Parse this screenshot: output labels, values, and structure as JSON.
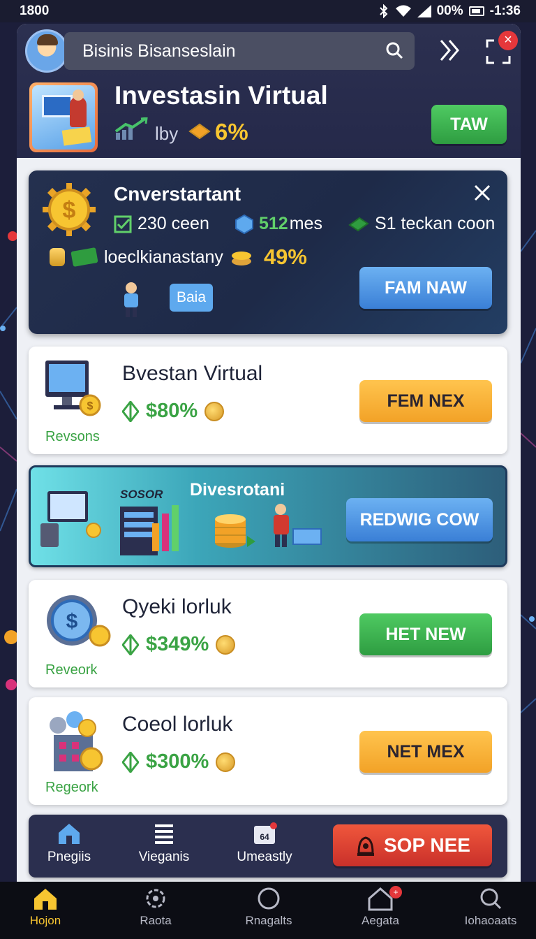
{
  "status_bar": {
    "time_left": "1800",
    "battery_text": "00%",
    "clock": "-1:36"
  },
  "header": {
    "search_text": "Bisinis Bisanseslain",
    "title": "Investasin Virtual",
    "by_label": "lby",
    "rate": "6%",
    "action_label": "TAW"
  },
  "promo": {
    "title": "Cnverstartant",
    "stat1": "230 ceen",
    "stat2_value": "512",
    "stat2_unit": "mes",
    "stat3": "S1 teckan coon",
    "line2_text": "loeclkianastany",
    "line2_pct": "49%",
    "chip_label": "Baia",
    "button_label": "FAM NAW"
  },
  "cards": [
    {
      "title": "Bvestan Virtual",
      "value": "$80%",
      "sub": "Revsons",
      "button": "FEM NEX"
    },
    {
      "title": "Qyeki lorluk",
      "value": "$349%",
      "sub": "Reveork",
      "button": "HET NEW"
    },
    {
      "title": "Coeol lorluk",
      "value": "$300%",
      "sub": "Regeork",
      "button": "NET MEX"
    }
  ],
  "feature": {
    "sign_text": "SOSOR",
    "title": "Divesrotani",
    "button": "REDWIG COW"
  },
  "bottom_strip": {
    "items": [
      "Pnegiis",
      "Vieganis",
      "Umeastly"
    ],
    "badge_text": "64",
    "button": "SOP NEE"
  },
  "nav": {
    "items": [
      "Hojon",
      "Raota",
      "Rnagalts",
      "Aegata",
      "Iohaoaats"
    ],
    "badge": "+"
  },
  "colors": {
    "accent_green": "#3aa344",
    "accent_gold": "#f7c531",
    "primary_blue": "#3a7fd6",
    "danger_red": "#e5373b"
  }
}
